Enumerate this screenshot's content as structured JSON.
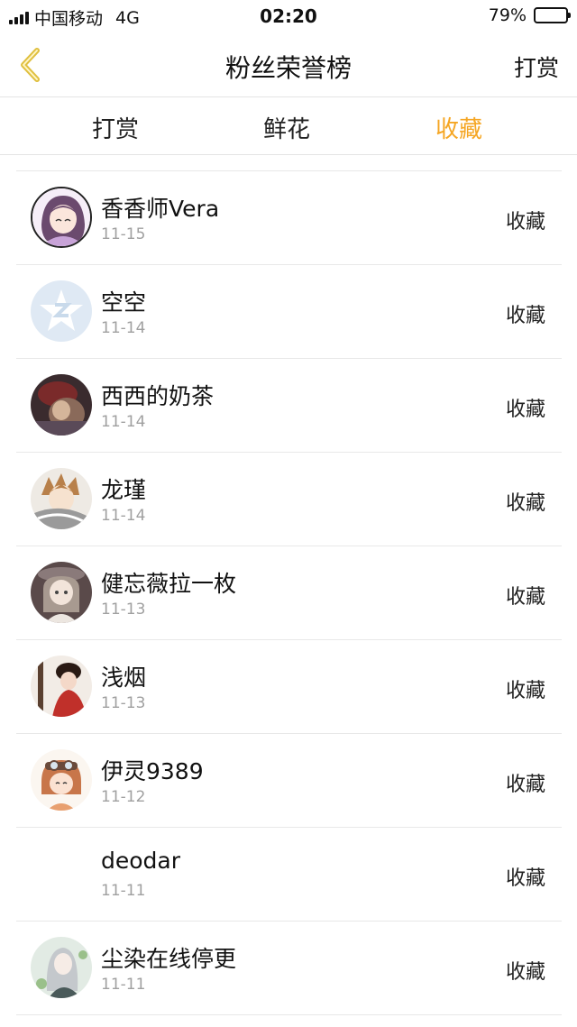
{
  "status_bar": {
    "carrier": "中国移动",
    "network": "4G",
    "time": "02:20",
    "battery": "79%",
    "battery_level": 0.79
  },
  "nav": {
    "back_icon": "chevron-left-icon",
    "title": "粉丝荣誉榜",
    "right_label": "打赏"
  },
  "tabs": [
    {
      "label": "打赏"
    },
    {
      "label": "鲜花"
    },
    {
      "label": "收藏",
      "active": true
    }
  ],
  "colors": {
    "accent": "#f5a623",
    "back_icon": "#e0c040",
    "divider": "#e8e8e8",
    "date_text": "#a0a0a0"
  },
  "fans": [
    {
      "name": "香香师Vera",
      "date": "11-15",
      "action": "收藏",
      "avatar": "avatar-girl-purple"
    },
    {
      "name": "空空",
      "date": "11-14",
      "action": "收藏",
      "avatar": "avatar-default-star"
    },
    {
      "name": "西西的奶茶",
      "date": "11-14",
      "action": "收藏",
      "avatar": "avatar-dark-photo"
    },
    {
      "name": "龙瑾",
      "date": "11-14",
      "action": "收藏",
      "avatar": "avatar-anime-boy"
    },
    {
      "name": "健忘薇拉一枚",
      "date": "11-13",
      "action": "收藏",
      "avatar": "avatar-anime-girl-hat"
    },
    {
      "name": "浅烟",
      "date": "11-13",
      "action": "收藏",
      "avatar": "avatar-red-dress"
    },
    {
      "name": "伊灵9389",
      "date": "11-12",
      "action": "收藏",
      "avatar": "avatar-goggles-girl"
    },
    {
      "name": "deodar",
      "date": "11-11",
      "action": "收藏",
      "avatar": "avatar-empty"
    },
    {
      "name": "尘染在线停更",
      "date": "11-11",
      "action": "收藏",
      "avatar": "avatar-silver-hair"
    }
  ]
}
